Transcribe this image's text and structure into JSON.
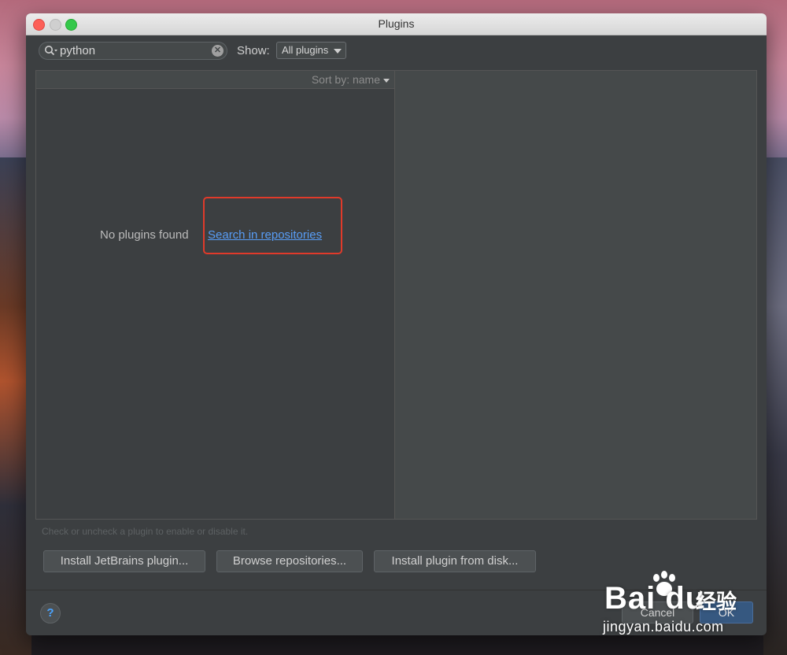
{
  "window": {
    "title": "Plugins"
  },
  "toolbar": {
    "search_value": "python",
    "show_label": "Show:",
    "show_selected": "All plugins"
  },
  "list": {
    "sort_label": "Sort by: name",
    "empty_text": "No plugins found",
    "search_link": "Search in repositories"
  },
  "hint": "Check or uncheck a plugin to enable or disable it.",
  "buttons": {
    "install_jetbrains": "Install JetBrains plugin...",
    "browse_repositories": "Browse repositories...",
    "install_from_disk": "Install plugin from disk...",
    "help": "?",
    "cancel": "Cancel",
    "ok": "OK"
  },
  "watermark": {
    "brand": "Bai du",
    "cn": "经验",
    "url": "jingyan.baidu.com"
  },
  "colors": {
    "highlight_border": "#e03a2a",
    "link": "#589df6",
    "ok_button": "#365880"
  },
  "icons": {
    "search": "search-icon",
    "clear": "clear-icon",
    "dropdown": "chevron-down-icon",
    "help": "help-icon"
  }
}
